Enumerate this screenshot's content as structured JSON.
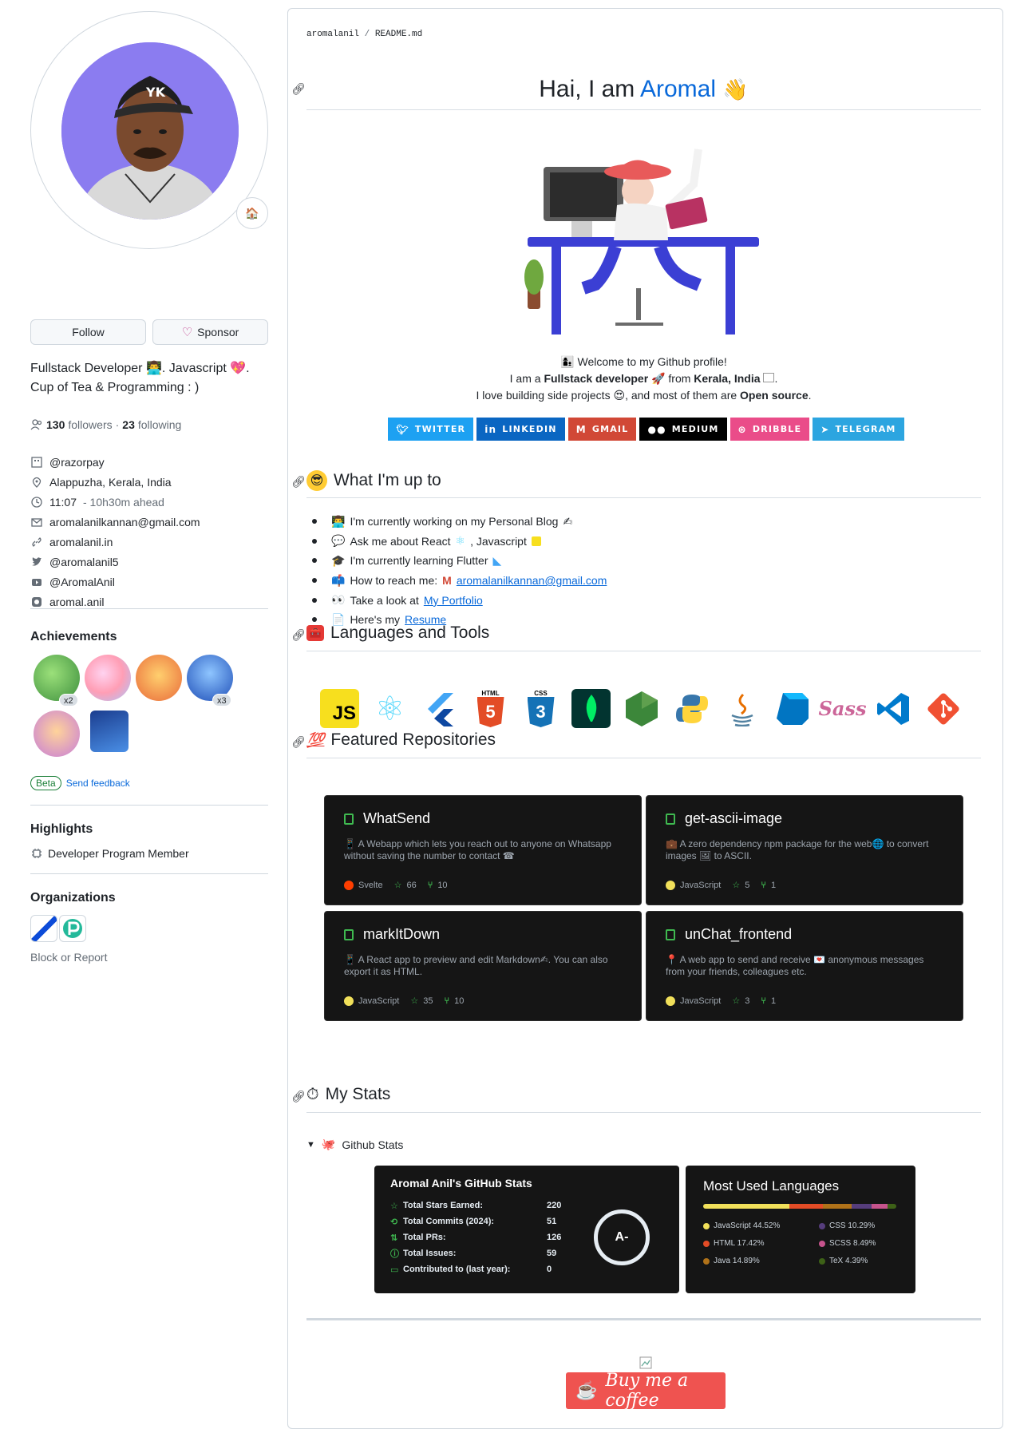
{
  "profile": {
    "follow_label": "Follow",
    "sponsor_label": "Sponsor",
    "bio_line1": "Fullstack Developer 👨‍💻. Javascript 💖.",
    "bio_line2": "Cup of Tea & Programming : )",
    "followers_count": "130",
    "followers_label": "followers",
    "sep": "·",
    "following_count": "23",
    "following_label": "following",
    "company": "@razorpay",
    "location": "Alappuzha, Kerala, India",
    "time": "11:07",
    "time_ahead": "- 10h30m ahead",
    "email": "aromalanilkannan@gmail.com",
    "website": "aromalanil.in",
    "twitter": "@aromalanil5",
    "youtube": "@AromalAnil",
    "other": "aromal.anil"
  },
  "achievements": {
    "heading": "Achievements",
    "badge_x2": "x2",
    "badge_x3": "x3",
    "beta_label": "Beta",
    "feedback_label": "Send feedback"
  },
  "highlights": {
    "heading": "Highlights",
    "item": "Developer Program Member"
  },
  "organizations": {
    "heading": "Organizations",
    "block_label": "Block or Report"
  },
  "readme": {
    "crumb_user": "aromalanil",
    "crumb_sep": " / ",
    "crumb_file": "README.md",
    "title_prefix": "Hai, I am",
    "title_name": "Aromal",
    "intro_line1": "Welcome to my Github profile!",
    "intro_l2_a": "I am a",
    "intro_l2_b": "Fullstack developer",
    "intro_l2_c": "from",
    "intro_l2_d": "Kerala, India",
    "intro_l3_a": "I love building side projects",
    "intro_l3_b": ", and most of them are",
    "intro_l3_c": "Open source",
    "intro_l3_d": ".",
    "socials": [
      {
        "label": "TWITTER",
        "color": "#1DA1F2"
      },
      {
        "label": "LINKEDIN",
        "color": "#0A66C2"
      },
      {
        "label": "GMAIL",
        "color": "#D14836"
      },
      {
        "label": "MEDIUM",
        "color": "#000000"
      },
      {
        "label": "DRIBBLE",
        "color": "#EA4C89"
      },
      {
        "label": "TELEGRAM",
        "color": "#2CA5E0"
      }
    ],
    "whats_up_heading": "What I'm up to",
    "up_items": {
      "i1": "I'm currently working on my Personal Blog",
      "i2a": "Ask me about React",
      "i2b": ", Javascript",
      "i3": "I'm currently learning Flutter",
      "i4a": "How to reach me:",
      "i4link": "aromalanilkannan@gmail.com",
      "i5a": "Take a look at",
      "i5link": "My Portfolio",
      "i6a": "Here's my",
      "i6link": "Resume"
    },
    "tools_heading": "Languages and Tools",
    "tools": {
      "js": "JS",
      "html": "HTML",
      "css": "CSS",
      "html_num": "5",
      "css_num": "3",
      "sass": "Sass"
    },
    "repos_heading": "Featured Repositories",
    "repos": [
      {
        "name": "WhatSend",
        "desc": "📱 A Webapp which lets you reach out to anyone on Whatsapp without saving the number to contact ☎",
        "lang": "Svelte",
        "lang_color": "#ff3e00",
        "stars": "66",
        "forks": "10"
      },
      {
        "name": "get-ascii-image",
        "desc": "💼 A zero dependency npm package for the web🌐 to convert images 🖼 to ASCII.",
        "lang": "JavaScript",
        "lang_color": "#f1e05a",
        "stars": "5",
        "forks": "1"
      },
      {
        "name": "markItDown",
        "desc": "📱 A React app to preview and edit Markdown✍. You can also export it as HTML.",
        "lang": "JavaScript",
        "lang_color": "#f1e05a",
        "stars": "35",
        "forks": "10"
      },
      {
        "name": "unChat_frontend",
        "desc": "📍 A web app to send and receive 💌 anonymous messages from your friends, colleagues etc.",
        "lang": "JavaScript",
        "lang_color": "#f1e05a",
        "stars": "3",
        "forks": "1"
      }
    ],
    "stats_heading": "My Stats",
    "details_label": "Github Stats",
    "stats_card": {
      "title": "Aromal Anil's GitHub Stats",
      "rows": [
        {
          "label": "Total Stars Earned:",
          "value": "220",
          "icon": "star-icon"
        },
        {
          "label": "Total Commits (2024):",
          "value": "51",
          "icon": "history-icon"
        },
        {
          "label": "Total PRs:",
          "value": "126",
          "icon": "pr-icon"
        },
        {
          "label": "Total Issues:",
          "value": "59",
          "icon": "issue-icon"
        },
        {
          "label": "Contributed to (last year):",
          "value": "0",
          "icon": "repo-icon"
        }
      ],
      "grade": "A-"
    },
    "langs_card": {
      "title": "Most Used Languages",
      "items": [
        {
          "name": "JavaScript 44.52%",
          "color": "#f1e05a",
          "pct": 44.52
        },
        {
          "name": "CSS 10.29%",
          "color": "#563d7c",
          "pct": 10.29
        },
        {
          "name": "HTML 17.42%",
          "color": "#e34c26",
          "pct": 17.42
        },
        {
          "name": "SCSS 8.49%",
          "color": "#c6538c",
          "pct": 8.49
        },
        {
          "name": "Java 14.89%",
          "color": "#b07219",
          "pct": 14.89
        },
        {
          "name": "TeX 4.39%",
          "color": "#3D6117",
          "pct": 4.39
        }
      ]
    },
    "coffee_label": "Buy me a coffee"
  }
}
